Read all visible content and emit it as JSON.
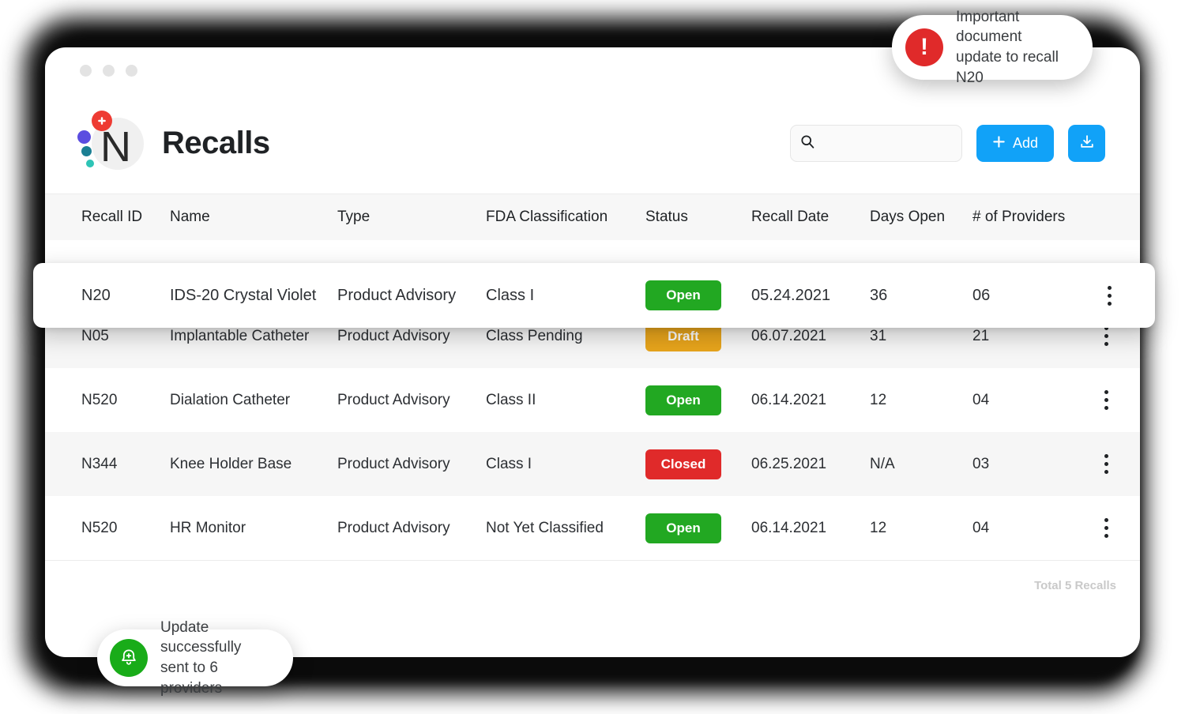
{
  "window": {
    "dots": [
      "dot-1",
      "dot-2",
      "dot-3"
    ]
  },
  "header": {
    "logo_letter": "N",
    "title": "Recalls",
    "search": {
      "value": "",
      "placeholder": ""
    },
    "add_label": "Add",
    "add_icon": "plus-icon",
    "download_icon": "download-icon",
    "accent_color": "#11a2f8"
  },
  "table": {
    "columns": [
      "Recall ID",
      "Name",
      "Type",
      "FDA Classification",
      "Status",
      "Recall Date",
      "Days Open",
      "# of Providers"
    ],
    "rows": [
      {
        "id": "N20",
        "name": "IDS-20 Crystal Violet",
        "type": "Product Advisory",
        "classification": "Class I",
        "status": "Open",
        "status_color": "#22a822",
        "date": "05.24.2021",
        "days_open": "36",
        "providers": "06",
        "highlighted": true
      },
      {
        "id": "N05",
        "name": "Implantable Catheter",
        "type": "Product Advisory",
        "classification": "Class Pending",
        "status": "Draft",
        "status_color": "#e8a51c",
        "date": "06.07.2021",
        "days_open": "31",
        "providers": "21",
        "highlighted": false
      },
      {
        "id": "N520",
        "name": "Dialation Catheter",
        "type": "Product Advisory",
        "classification": "Class II",
        "status": "Open",
        "status_color": "#22a822",
        "date": "06.14.2021",
        "days_open": "12",
        "providers": "04",
        "highlighted": false
      },
      {
        "id": "N344",
        "name": "Knee Holder Base",
        "type": "Product Advisory",
        "classification": "Class I",
        "status": "Closed",
        "status_color": "#e02a2a",
        "date": "06.25.2021",
        "days_open": "N/A",
        "providers": "03",
        "highlighted": false
      },
      {
        "id": "N520",
        "name": "HR Monitor",
        "type": "Product Advisory",
        "classification": "Not Yet Classified",
        "status": "Open",
        "status_color": "#22a822",
        "date": "06.14.2021",
        "days_open": "12",
        "providers": "04",
        "highlighted": false
      }
    ],
    "footer_total": "Total 5 Recalls",
    "row_menu_icon": "kebab-menu-icon"
  },
  "toasts": {
    "alert": {
      "icon": "alert-exclamation-icon",
      "icon_color": "#e02a2a",
      "text": "Important document\nupdate to recall N20"
    },
    "success": {
      "icon": "bell-plus-icon",
      "icon_color": "#19ac19",
      "text": "Update successfully\nsent to 6 providers"
    }
  }
}
